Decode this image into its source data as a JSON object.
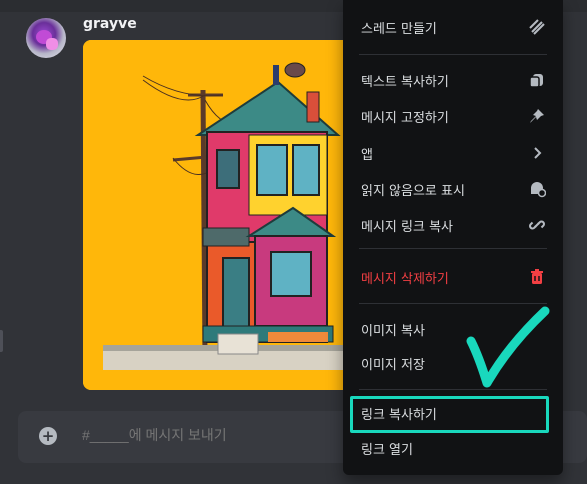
{
  "message": {
    "username": "grayve"
  },
  "composer": {
    "placeholder": "#_____에 메시지 보내기"
  },
  "context_menu": {
    "items": [
      {
        "label": "스레드 만들기",
        "icon": "thread-icon"
      },
      {
        "label": "텍스트 복사하기",
        "icon": "copy-text-icon"
      },
      {
        "label": "메시지 고정하기",
        "icon": "pin-icon"
      },
      {
        "label": "앱",
        "icon": "chevron-right-icon"
      },
      {
        "label": "읽지 않음으로 표시",
        "icon": "mark-unread-icon"
      },
      {
        "label": "메시지 링크 복사",
        "icon": "link-icon"
      },
      {
        "label": "메시지 삭제하기",
        "icon": "trash-icon"
      },
      {
        "label": "이미지 복사",
        "icon": ""
      },
      {
        "label": "이미지 저장",
        "icon": ""
      },
      {
        "label": "링크 복사하기",
        "icon": ""
      },
      {
        "label": "링크 열기",
        "icon": ""
      }
    ]
  },
  "colors": {
    "background": "#313338",
    "menu": "#111214",
    "danger": "#f23f43",
    "highlight": "#19d8bd",
    "image_bg": "#ffb70a"
  }
}
